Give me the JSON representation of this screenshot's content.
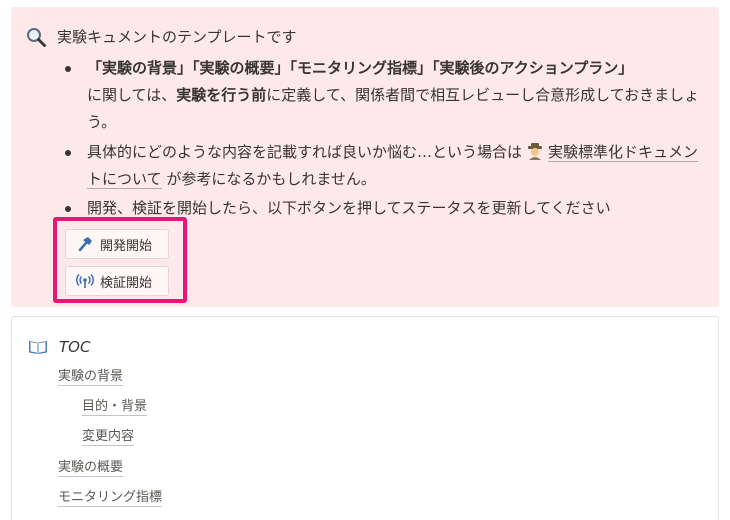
{
  "callout": {
    "icon": "magnifier-icon",
    "title": "実験キュメントのテンプレートです",
    "bullet1": {
      "part1": "「実験の背景」「実験の概要」「モニタリング指標」「実験後のアクションプラン」",
      "part2": "に関しては、",
      "part3": "実験を行う前",
      "part4": "に定義して、関係者間で相互レビューし合意形成しておきましょう。"
    },
    "bullet2": {
      "part1": "具体的にどのような内容を記載すれば良いか悩む…という場合は",
      "link_icon": "detective-icon",
      "link": "実験標準化ドキュメントについて",
      "part2": " が参考になるかもしれません。"
    },
    "bullet3": "開発、検証を開始したら、以下ボタンを押してステータスを更新してください",
    "buttons": [
      {
        "label": "開発開始",
        "icon": "hammer-icon"
      },
      {
        "label": "検証開始",
        "icon": "broadcast-icon"
      }
    ],
    "highlight_color": "#e8157a",
    "background": "#fde9e9"
  },
  "toc": {
    "icon": "open-book-icon",
    "title": "TOC",
    "items": [
      "実験の背景",
      "目的・背景",
      "変更内容",
      "実験の概要",
      "モニタリング指標"
    ]
  }
}
